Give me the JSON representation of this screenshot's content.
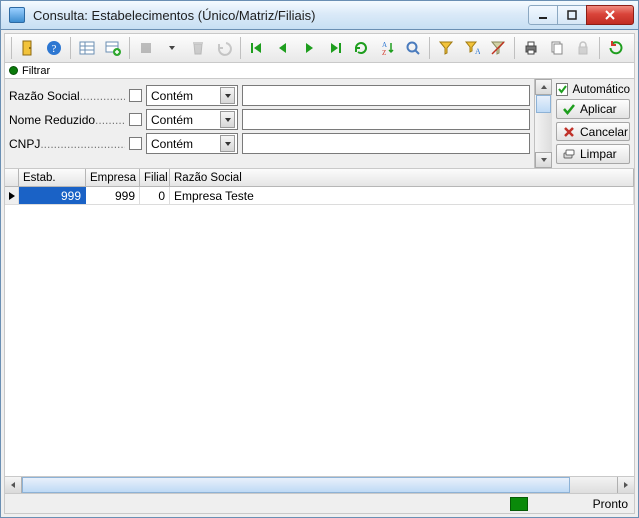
{
  "window": {
    "title": "Consulta: Estabelecimentos (Único/Matriz/Filiais)"
  },
  "toolbar": {
    "icons": [
      "door-exit",
      "help",
      "grid-view",
      "grid-add",
      "stop",
      "trash",
      "undo",
      "nav-first",
      "nav-prev",
      "nav-next",
      "nav-last",
      "refresh",
      "sort-az",
      "zoom",
      "funnel",
      "funnel-a",
      "funnel-strike",
      "print",
      "copy",
      "lock",
      "refresh-alt"
    ]
  },
  "filter": {
    "header_label": "Filtrar",
    "rows": [
      {
        "label": "Razão Social",
        "op": "Contém",
        "value": ""
      },
      {
        "label": "Nome Reduzido",
        "op": "Contém",
        "value": ""
      },
      {
        "label": "CNPJ",
        "op": "Contém",
        "value": ""
      }
    ],
    "automatic_label": "Automático",
    "automatic_checked": true,
    "apply_label": "Aplicar",
    "cancel_label": "Cancelar",
    "clear_label": "Limpar"
  },
  "grid": {
    "columns": [
      "Estab.",
      "Empresa",
      "Filial",
      "Razão Social"
    ],
    "rows": [
      {
        "estab": "999",
        "empresa": "999",
        "filial": "0",
        "razao": "Empresa Teste",
        "selected": true
      }
    ]
  },
  "status": {
    "text": "Pronto"
  }
}
